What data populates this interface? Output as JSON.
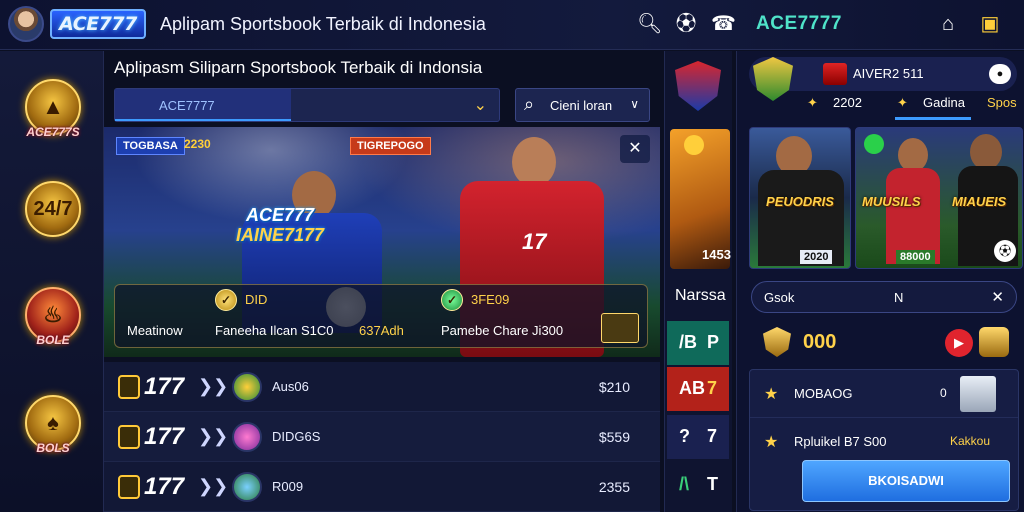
{
  "header": {
    "title": "Aplipam Sportsbook Terbaik di Indonesia",
    "logo_text": "ACE777",
    "brand_right": "ACE7777",
    "icons": [
      "search-icon",
      "soccer-ball-icon",
      "support-icon",
      "home-icon",
      "shop-icon"
    ]
  },
  "sidebar": {
    "items": [
      {
        "label": "ACE777S",
        "icon": "trophy-emblem-icon"
      },
      {
        "label": "24/7",
        "icon": "laurel-badge-icon"
      },
      {
        "label": "BOLE",
        "icon": "flame-trophy-icon"
      },
      {
        "label": "BOLS",
        "icon": "gold-cup-icon"
      }
    ]
  },
  "main": {
    "heading": "Aplipasm Siliparn Sportsbook Terbaik di Indonsia",
    "filter_label": "ACE7777",
    "search_label": "Cieni loran",
    "hero": {
      "tag1": "TOGBASA",
      "tag2": "2230",
      "tag3": "TIGREPOGO",
      "jersey_line1": "ACE777",
      "jersey_line2": "IAINE7177",
      "player2_number": "17",
      "stat1_value": "DID",
      "stat1_label1": "Meatinow",
      "stat1_label2": "Faneeha Ilcan S1C0",
      "stat1_label3": "637Adh",
      "stat2_value": "3FE09",
      "stat2_label": "Pamebe Chare Ji300"
    },
    "rows": [
      {
        "num": "177",
        "name": "Aus06",
        "amount": "$210"
      },
      {
        "num": "177",
        "name": "DIDG6S",
        "amount": "$559"
      },
      {
        "num": "177",
        "name": "R009",
        "amount": "2355"
      }
    ]
  },
  "middle": {
    "card_number": "1453",
    "label": "Narssa",
    "tiles": [
      {
        "glyph": "/B",
        "side": "P"
      },
      {
        "glyph": "AB",
        "side": "7"
      },
      {
        "glyph": "?",
        "side": "7"
      },
      {
        "glyph": "/\\",
        "side": "T"
      }
    ]
  },
  "right": {
    "top_name": "AIVER2 511",
    "tab1_value": "2202",
    "tab2_label": "Gadina",
    "tab3_label": "Spos",
    "promos": [
      {
        "caption": "PEUODRIS",
        "foot": "2020"
      },
      {
        "caption": "MUUSILS",
        "foot": "88000"
      },
      {
        "caption": "MIAUEIS",
        "foot": ""
      }
    ],
    "search_label": "Gsok",
    "search_mid": "N",
    "score_value": "000",
    "list": [
      {
        "text": "MOBAOG",
        "value": "0"
      },
      {
        "text": "Rpluikel B7 S00",
        "value": "Kakkou"
      }
    ],
    "cta_label": "BKOISADWI"
  },
  "colors": {
    "background": "#0b0f22",
    "accent_blue": "#3d9bff",
    "accent_gold": "#ffd24a",
    "brand_teal": "#4fe3c9"
  }
}
